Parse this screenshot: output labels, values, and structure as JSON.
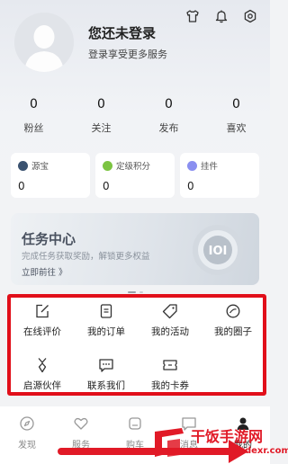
{
  "profile": {
    "title": "您还未登录",
    "subtitle": "登录享受更多服务"
  },
  "top_icons": [
    "shirt-icon",
    "bell-icon",
    "settings-hex-icon"
  ],
  "stats": [
    {
      "value": "0",
      "label": "粉丝"
    },
    {
      "value": "0",
      "label": "关注"
    },
    {
      "value": "0",
      "label": "发布"
    },
    {
      "value": "0",
      "label": "喜欢"
    }
  ],
  "cards": [
    {
      "title": "源宝",
      "value": "0",
      "icon_color": "#3a5270"
    },
    {
      "title": "定级积分",
      "value": "0",
      "icon_color": "#7cc442"
    },
    {
      "title": "挂件",
      "value": "0",
      "icon_color": "#8a8ff0"
    }
  ],
  "banner": {
    "title": "任务中心",
    "subtitle": "完成任务获取奖励，解锁更多权益",
    "cta": "立即前往 》"
  },
  "services": [
    {
      "label": "在线评价",
      "icon": "edit-icon"
    },
    {
      "label": "我的订单",
      "icon": "order-icon"
    },
    {
      "label": "我的活动",
      "icon": "tag-icon"
    },
    {
      "label": "我的圈子",
      "icon": "circle-icon"
    },
    {
      "label": "启源伙伴",
      "icon": "medal-icon"
    },
    {
      "label": "联系我们",
      "icon": "chat-icon"
    },
    {
      "label": "我的卡券",
      "icon": "ticket-icon"
    }
  ],
  "tabs": [
    {
      "label": "发现",
      "icon": "compass-icon"
    },
    {
      "label": "服务",
      "icon": "heart-icon"
    },
    {
      "label": "购车",
      "icon": "car-icon"
    },
    {
      "label": "消息",
      "icon": "chat-tab-icon"
    },
    {
      "label": "我的",
      "icon": "user-icon"
    }
  ],
  "active_tab": 4,
  "highlight_color": "#e10f1a",
  "watermark": {
    "name": "干饭手游网",
    "url": "www.gfxudexr.com"
  }
}
